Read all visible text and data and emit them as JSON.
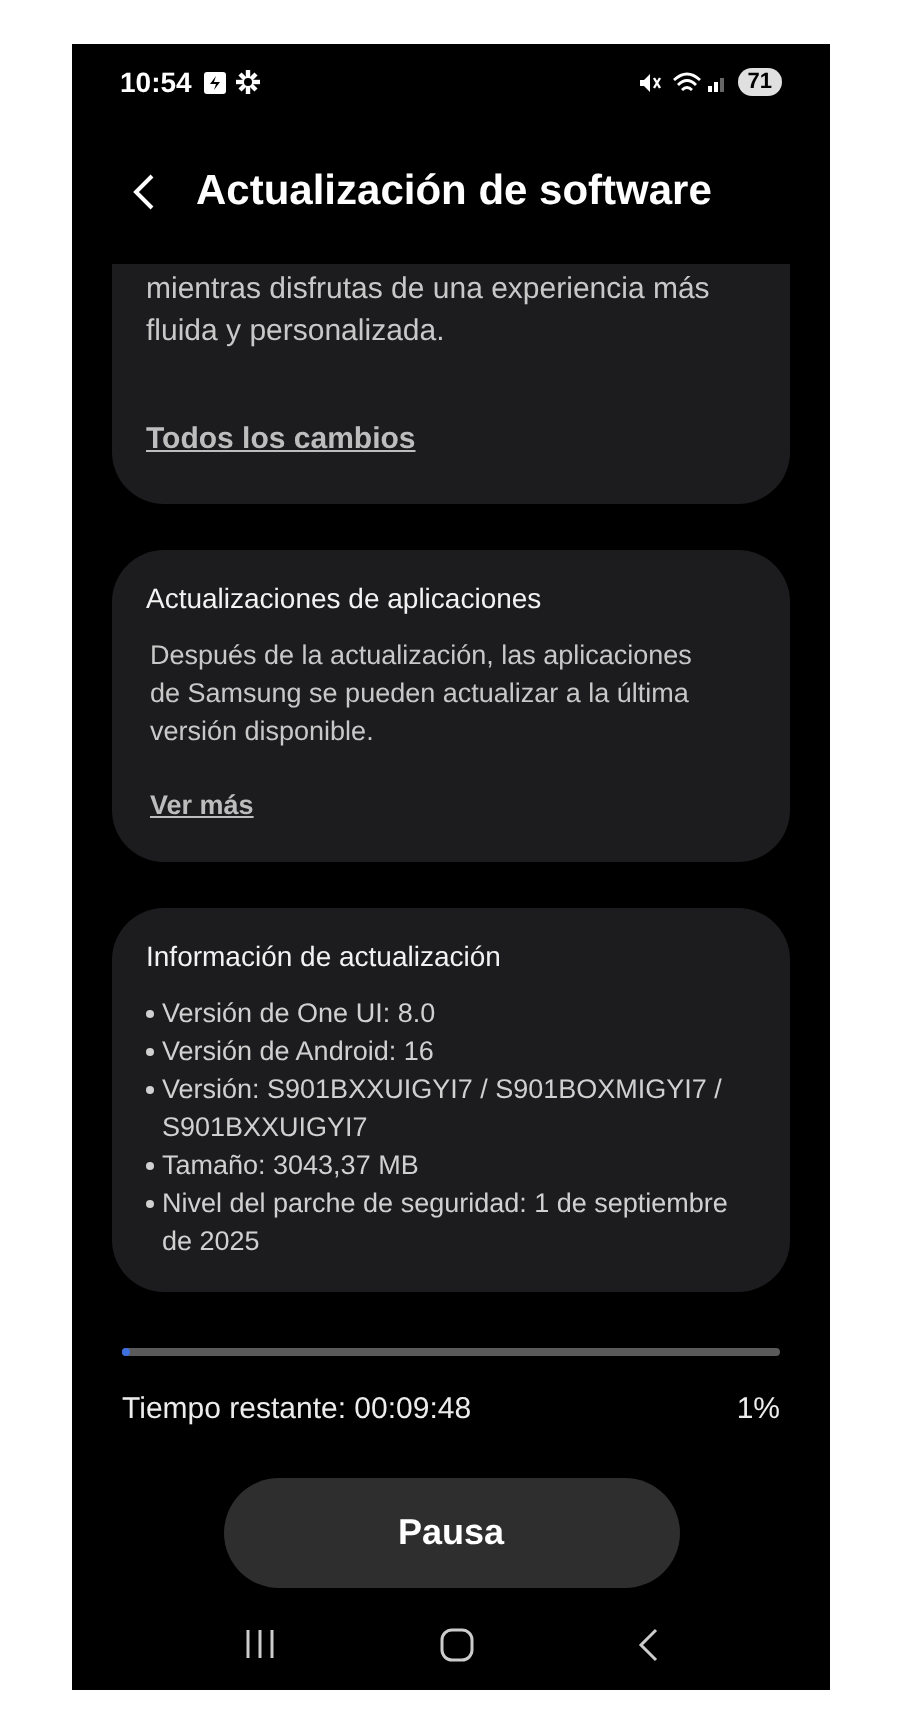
{
  "status_bar": {
    "time": "10:54",
    "battery": "71"
  },
  "header": {
    "title": "Actualización de software"
  },
  "cards": [
    {
      "kind": "text",
      "body": "mientras disfrutas de una experiencia más fluida y personalizada.",
      "link": "Todos los cambios"
    },
    {
      "kind": "text",
      "title": "Actualizaciones de aplicaciones",
      "body": "Después de la actualización, las aplicaciones de Samsung se pueden actualizar a la última versión disponible.",
      "link": "Ver más"
    },
    {
      "kind": "list",
      "title": "Información de actualización",
      "items": [
        "Versión de One UI: 8.0",
        "Versión de Android: 16",
        "Versión: S901BXXUIGYI7 / S901BOXMIGYI7 / S901BXXUIGYI7",
        "Tamaño: 3043,37 MB",
        "Nivel del parche de seguridad: 1 de septiembre de 2025"
      ]
    }
  ],
  "progress": {
    "level": 0.01,
    "remaining": "Tiempo restante: 00:09:48",
    "percent": "1%"
  },
  "button": "Pausa"
}
